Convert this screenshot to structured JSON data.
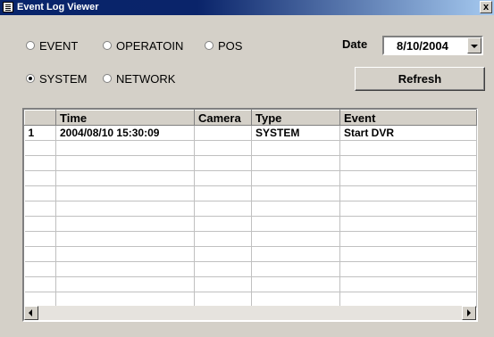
{
  "window": {
    "title": "Event Log Viewer",
    "close_label": "x"
  },
  "filters": [
    {
      "label": "EVENT",
      "checked": false
    },
    {
      "label": "OPERATOIN",
      "checked": false
    },
    {
      "label": "POS",
      "checked": false
    },
    {
      "label": "SYSTEM",
      "checked": true
    },
    {
      "label": "NETWORK",
      "checked": false
    }
  ],
  "date": {
    "label": "Date",
    "value": "8/10/2004"
  },
  "refresh_label": "Refresh",
  "grid": {
    "columns": [
      "",
      "Time",
      "Camera",
      "Type",
      "Event"
    ],
    "rows": [
      [
        "1",
        "2004/08/10 15:30:09",
        "",
        "SYSTEM",
        "Start DVR"
      ],
      [
        "",
        "",
        "",
        "",
        ""
      ],
      [
        "",
        "",
        "",
        "",
        ""
      ],
      [
        "",
        "",
        "",
        "",
        ""
      ],
      [
        "",
        "",
        "",
        "",
        ""
      ],
      [
        "",
        "",
        "",
        "",
        ""
      ],
      [
        "",
        "",
        "",
        "",
        ""
      ],
      [
        "",
        "",
        "",
        "",
        ""
      ],
      [
        "",
        "",
        "",
        "",
        ""
      ],
      [
        "",
        "",
        "",
        "",
        ""
      ],
      [
        "",
        "",
        "",
        "",
        ""
      ],
      [
        "",
        "",
        "",
        "",
        ""
      ]
    ]
  },
  "icons": {
    "window": "event-log-icon",
    "scroll_left": "scroll-left-arrow-icon",
    "scroll_right": "scroll-right-arrow-icon",
    "dropdown": "chevron-down-icon"
  }
}
